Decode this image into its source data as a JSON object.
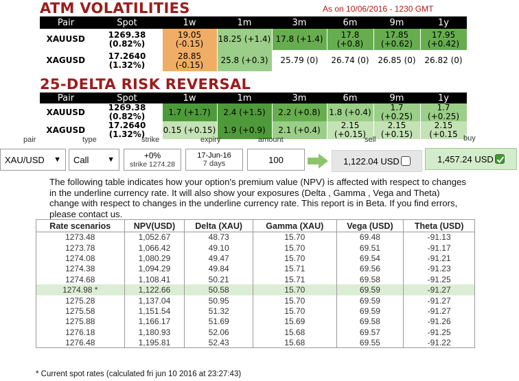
{
  "atm": {
    "title": "ATM VOLATILITIES",
    "as_of": "As on 10/06/2016 - 1230 GMT",
    "headers": [
      "Pair",
      "Spot",
      "1w",
      "1m",
      "3m",
      "6m",
      "9m",
      "1y"
    ],
    "rows": [
      {
        "pair": "XAUUSD",
        "spot": "1269.38 (0.82%)",
        "cells": [
          {
            "text": "19.05\n(-0.15)",
            "color": "orange"
          },
          {
            "text": "18.25 (+1.4)",
            "color": "g2"
          },
          {
            "text": "17.8 (+1.4)",
            "color": "g3"
          },
          {
            "text": "17.8 (+0.8)",
            "color": "g3"
          },
          {
            "text": "17.85\n(+0.62)",
            "color": "g3"
          },
          {
            "text": "17.95\n(+0.42)",
            "color": "g3"
          }
        ]
      },
      {
        "pair": "XAGUSD",
        "spot": "17.2640 (1.32%)",
        "cells": [
          {
            "text": "28.85\n(-0.15)",
            "color": "orange"
          },
          {
            "text": "25.8 (+0.3)",
            "color": "g2"
          },
          {
            "text": "25.79 (0)",
            "color": "white"
          },
          {
            "text": "26.74 (0)",
            "color": "white"
          },
          {
            "text": "26.85 (0)",
            "color": "white"
          },
          {
            "text": "26.82 (0)",
            "color": "white"
          }
        ]
      }
    ]
  },
  "rr": {
    "title": "25-DELTA RISK REVERSAL",
    "headers": [
      "Pair",
      "Spot",
      "1w",
      "1m",
      "3m",
      "6m",
      "9m",
      "1y"
    ],
    "rows": [
      {
        "pair": "XAUUSD",
        "spot": "1269.38 (0.82%)",
        "cells": [
          {
            "text": "1.7 (+1.7)",
            "color": "g4"
          },
          {
            "text": "2.4 (+1.5)",
            "color": "g4"
          },
          {
            "text": "2.2 (+0.8)",
            "color": "g3"
          },
          {
            "text": "1.8 (+0.4)",
            "color": "g2"
          },
          {
            "text": "1.7 (+0.25)",
            "color": "g2"
          },
          {
            "text": "1.7 (+0.25)",
            "color": "g2"
          }
        ]
      },
      {
        "pair": "XAGUSD",
        "spot": "17.2640 (1.32%)",
        "cells": [
          {
            "text": "0.15 (+0.15)",
            "color": "g1"
          },
          {
            "text": "1.9 (+0.9)",
            "color": "g4"
          },
          {
            "text": "2.1 (+0.4)",
            "color": "g2"
          },
          {
            "text": "2.15 (+0.15)",
            "color": "g1"
          },
          {
            "text": "2.15 (+0.15)",
            "color": "g1"
          },
          {
            "text": "2.15 (+0.15",
            "color": "g1"
          }
        ]
      }
    ]
  },
  "calc": {
    "labels": {
      "pair": "pair",
      "type": "type",
      "strike": "strike",
      "expiry": "expiry",
      "amount": "amount",
      "sell": "sell",
      "buy": "buy"
    },
    "pair_value": "XAU/USD",
    "type_value": "Call",
    "strike_pct": "+0%",
    "strike_value": "strike 1274.28",
    "expiry_date": "17-Jun-16",
    "expiry_days": "7 days",
    "amount": "100",
    "sell_price": "1,122.04 USD",
    "buy_price": "1,457.24 USD"
  },
  "description": "The following table indicates how your option's premium value (NPV) is affected with respect to changes in the underline currency rate. It will also show your exposures (Delta , Gamma , Vega and Theta) change with respect to changes in the underline currency rate. This report is in Beta. If you find errors, please contact us.",
  "rates_table": {
    "headers": [
      "Rate scenarios",
      "NPV(USD)",
      "Delta (XAU)",
      "Gamma (XAU)",
      "Vega (USD)",
      "Theta (USD)"
    ],
    "rows": [
      [
        "1273.48",
        "1,052.67",
        "48.73",
        "15.70",
        "69.48",
        "-91.13"
      ],
      [
        "1273.78",
        "1,066.42",
        "49.10",
        "15.70",
        "69.51",
        "-91.17"
      ],
      [
        "1274.08",
        "1,080.29",
        "49.47",
        "15.70",
        "69.54",
        "-91.21"
      ],
      [
        "1274.38",
        "1,094.29",
        "49.84",
        "15.71",
        "69.56",
        "-91.23"
      ],
      [
        "1274.68",
        "1,108.41",
        "50.21",
        "15.71",
        "69.58",
        "-91.25"
      ],
      [
        "1274.98 *",
        "1,122.66",
        "50.58",
        "15.70",
        "69.59",
        "-91.27"
      ],
      [
        "1275.28",
        "1,137.04",
        "50.95",
        "15.70",
        "69.59",
        "-91.27"
      ],
      [
        "1275.58",
        "1,151.54",
        "51.32",
        "15.70",
        "69.59",
        "-91.27"
      ],
      [
        "1275.88",
        "1,166.17",
        "51.69",
        "15.69",
        "69.58",
        "-91.26"
      ],
      [
        "1276.18",
        "1,180.93",
        "52.06",
        "15.68",
        "69.57",
        "-91.25"
      ],
      [
        "1276.48",
        "1,195.81",
        "52.43",
        "15.68",
        "69.55",
        "-91.22"
      ]
    ],
    "current_index": 5
  },
  "footnote": "* Current spot rates (calculated fri jun 10 2016 at 23:27:43)"
}
